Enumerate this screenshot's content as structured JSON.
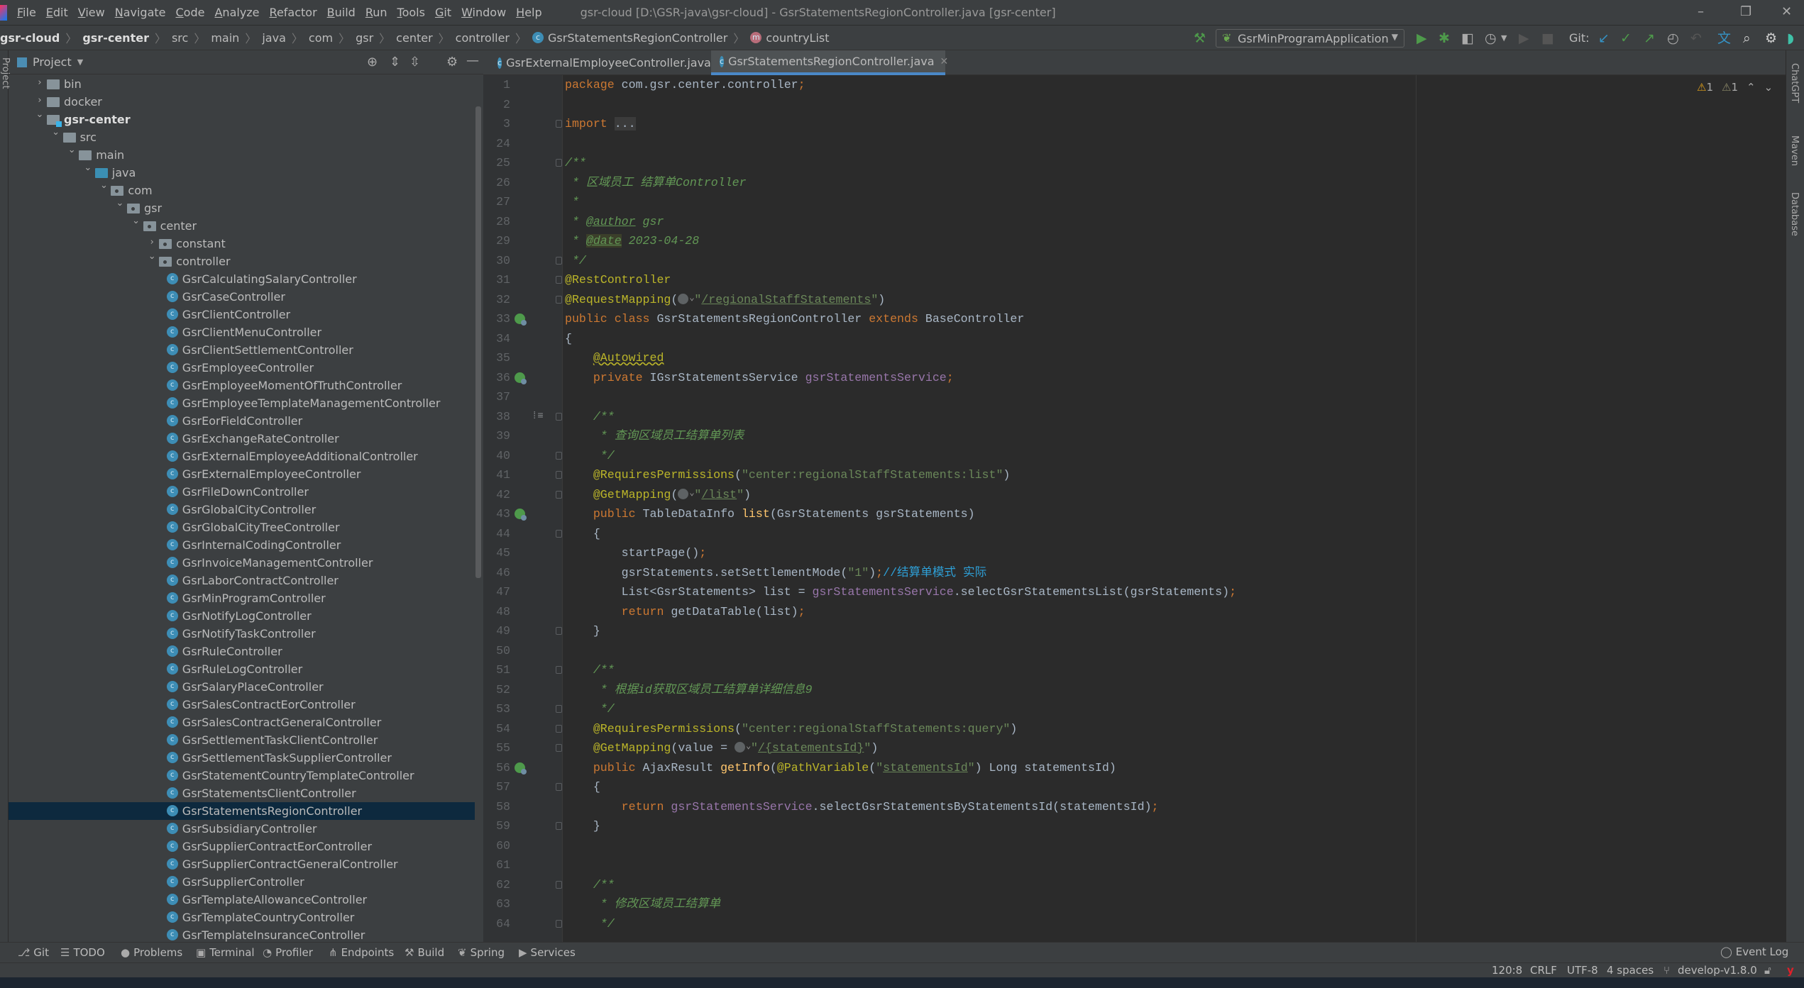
{
  "menubar": {
    "items": [
      "File",
      "Edit",
      "View",
      "Navigate",
      "Code",
      "Analyze",
      "Refactor",
      "Build",
      "Run",
      "Tools",
      "Git",
      "Window",
      "Help"
    ],
    "title": "gsr-cloud [D:\\GSR-java\\gsr-cloud] - GsrStatementsRegionController.java [gsr-center]"
  },
  "breadcrumb": [
    "gsr-cloud",
    "gsr-center",
    "src",
    "main",
    "java",
    "com",
    "gsr",
    "center",
    "controller",
    "GsrStatementsRegionController",
    "countryList"
  ],
  "toolbar": {
    "run_config": "GsrMinProgramApplication",
    "git_label": "Git:"
  },
  "project": {
    "title": "Project",
    "tree": [
      {
        "label": "bin",
        "level": 0,
        "kind": "folder",
        "expanded": false
      },
      {
        "label": "docker",
        "level": 0,
        "kind": "folder",
        "expanded": false
      },
      {
        "label": "gsr-center",
        "level": 0,
        "kind": "module",
        "expanded": true
      },
      {
        "label": "src",
        "level": 1,
        "kind": "folder",
        "expanded": true
      },
      {
        "label": "main",
        "level": 2,
        "kind": "folder",
        "expanded": true
      },
      {
        "label": "java",
        "level": 3,
        "kind": "source",
        "expanded": true
      },
      {
        "label": "com",
        "level": 4,
        "kind": "package",
        "expanded": true
      },
      {
        "label": "gsr",
        "level": 5,
        "kind": "package",
        "expanded": true
      },
      {
        "label": "center",
        "level": 6,
        "kind": "package",
        "expanded": true
      },
      {
        "label": "constant",
        "level": 7,
        "kind": "package",
        "expanded": false
      },
      {
        "label": "controller",
        "level": 7,
        "kind": "package",
        "expanded": true
      },
      {
        "label": "GsrCalculatingSalaryController",
        "level": 8,
        "kind": "class"
      },
      {
        "label": "GsrCaseController",
        "level": 8,
        "kind": "class"
      },
      {
        "label": "GsrClientController",
        "level": 8,
        "kind": "class"
      },
      {
        "label": "GsrClientMenuController",
        "level": 8,
        "kind": "class"
      },
      {
        "label": "GsrClientSettlementController",
        "level": 8,
        "kind": "class"
      },
      {
        "label": "GsrEmployeeController",
        "level": 8,
        "kind": "class"
      },
      {
        "label": "GsrEmployeeMomentOfTruthController",
        "level": 8,
        "kind": "class"
      },
      {
        "label": "GsrEmployeeTemplateManagementController",
        "level": 8,
        "kind": "class"
      },
      {
        "label": "GsrEorFieldController",
        "level": 8,
        "kind": "class"
      },
      {
        "label": "GsrExchangeRateController",
        "level": 8,
        "kind": "class"
      },
      {
        "label": "GsrExternalEmployeeAdditionalController",
        "level": 8,
        "kind": "class"
      },
      {
        "label": "GsrExternalEmployeeController",
        "level": 8,
        "kind": "class"
      },
      {
        "label": "GsrFileDownController",
        "level": 8,
        "kind": "class"
      },
      {
        "label": "GsrGlobalCityController",
        "level": 8,
        "kind": "class"
      },
      {
        "label": "GsrGlobalCityTreeController",
        "level": 8,
        "kind": "class"
      },
      {
        "label": "GsrInternalCodingController",
        "level": 8,
        "kind": "class"
      },
      {
        "label": "GsrInvoiceManagementController",
        "level": 8,
        "kind": "class"
      },
      {
        "label": "GsrLaborContractController",
        "level": 8,
        "kind": "class"
      },
      {
        "label": "GsrMinProgramController",
        "level": 8,
        "kind": "class"
      },
      {
        "label": "GsrNotifyLogController",
        "level": 8,
        "kind": "class"
      },
      {
        "label": "GsrNotifyTaskController",
        "level": 8,
        "kind": "class"
      },
      {
        "label": "GsrRuleController",
        "level": 8,
        "kind": "class"
      },
      {
        "label": "GsrRuleLogController",
        "level": 8,
        "kind": "class"
      },
      {
        "label": "GsrSalaryPlaceController",
        "level": 8,
        "kind": "class"
      },
      {
        "label": "GsrSalesContractEorController",
        "level": 8,
        "kind": "class"
      },
      {
        "label": "GsrSalesContractGeneralController",
        "level": 8,
        "kind": "class"
      },
      {
        "label": "GsrSettlementTaskClientController",
        "level": 8,
        "kind": "class"
      },
      {
        "label": "GsrSettlementTaskSupplierController",
        "level": 8,
        "kind": "class"
      },
      {
        "label": "GsrStatementCountryTemplateController",
        "level": 8,
        "kind": "class"
      },
      {
        "label": "GsrStatementsClientController",
        "level": 8,
        "kind": "class"
      },
      {
        "label": "GsrStatementsRegionController",
        "level": 8,
        "kind": "class",
        "selected": true
      },
      {
        "label": "GsrSubsidiaryController",
        "level": 8,
        "kind": "class"
      },
      {
        "label": "GsrSupplierContractEorController",
        "level": 8,
        "kind": "class"
      },
      {
        "label": "GsrSupplierContractGeneralController",
        "level": 8,
        "kind": "class"
      },
      {
        "label": "GsrSupplierController",
        "level": 8,
        "kind": "class"
      },
      {
        "label": "GsrTemplateAllowanceController",
        "level": 8,
        "kind": "class"
      },
      {
        "label": "GsrTemplateCountryController",
        "level": 8,
        "kind": "class"
      },
      {
        "label": "GsrTemplateInsuranceController",
        "level": 8,
        "kind": "class"
      }
    ]
  },
  "tabs": [
    {
      "label": "GsrExternalEmployeeController.java",
      "active": false
    },
    {
      "label": "GsrStatementsRegionController.java",
      "active": true
    }
  ],
  "editor": {
    "warnings": [
      "1",
      "1"
    ],
    "lines": [
      {
        "n": "1",
        "t": [
          [
            "kw",
            "package"
          ],
          [
            "plain",
            " com.gsr.center.controller"
          ],
          [
            "kw",
            ";"
          ]
        ]
      },
      {
        "n": "2",
        "t": []
      },
      {
        "n": "3",
        "fold": true,
        "t": [
          [
            "kw",
            "import "
          ],
          [
            "foldtxt",
            "..."
          ]
        ]
      },
      {
        "n": "24",
        "t": []
      },
      {
        "n": "25",
        "fold": true,
        "t": [
          [
            "doc",
            "/**"
          ]
        ]
      },
      {
        "n": "26",
        "t": [
          [
            "doc",
            " * 区域员工 结算单Controller"
          ]
        ]
      },
      {
        "n": "27",
        "t": [
          [
            "doc",
            " *"
          ]
        ]
      },
      {
        "n": "28",
        "t": [
          [
            "doc",
            " * "
          ],
          [
            "doctag",
            "@author"
          ],
          [
            "doc",
            " gsr"
          ]
        ]
      },
      {
        "n": "29",
        "t": [
          [
            "doc",
            " * "
          ],
          [
            "doctaghl",
            "@date"
          ],
          [
            "doc",
            " 2023-04-28"
          ]
        ]
      },
      {
        "n": "30",
        "fold": true,
        "t": [
          [
            "doc",
            " */"
          ]
        ]
      },
      {
        "n": "31",
        "fold": true,
        "t": [
          [
            "ann",
            "@RestController"
          ]
        ]
      },
      {
        "n": "32",
        "fold": true,
        "t": [
          [
            "ann",
            "@RequestMapping"
          ],
          [
            "plain",
            "("
          ],
          [
            "globe",
            ""
          ],
          [
            "str",
            "\""
          ],
          [
            "url",
            "/regionalStaffStatements"
          ],
          [
            "str",
            "\""
          ],
          [
            "plain",
            ")"
          ]
        ]
      },
      {
        "n": "33",
        "bean": true,
        "t": [
          [
            "kw",
            "public class "
          ],
          [
            "plain",
            "GsrStatementsRegionController "
          ],
          [
            "kw",
            "extends "
          ],
          [
            "plain",
            "BaseController"
          ]
        ]
      },
      {
        "n": "34",
        "t": [
          [
            "plain",
            "{"
          ]
        ]
      },
      {
        "n": "35",
        "t": [
          [
            "plain",
            "    "
          ],
          [
            "annu",
            "@Autowired"
          ]
        ]
      },
      {
        "n": "36",
        "bean": true,
        "t": [
          [
            "kw",
            "    private "
          ],
          [
            "plain",
            "IGsrStatementsService "
          ],
          [
            "field",
            "gsrStatementsService"
          ],
          [
            "kw",
            ";"
          ]
        ]
      },
      {
        "n": "37",
        "t": []
      },
      {
        "n": "38",
        "fold": true,
        "impl": true,
        "t": [
          [
            "doc",
            "    /**"
          ]
        ]
      },
      {
        "n": "39",
        "t": [
          [
            "doc",
            "     * 查询区域员工结算单列表"
          ]
        ]
      },
      {
        "n": "40",
        "fold": true,
        "t": [
          [
            "doc",
            "     */"
          ]
        ]
      },
      {
        "n": "41",
        "fold": true,
        "t": [
          [
            "ann",
            "    @RequiresPermissions"
          ],
          [
            "plain",
            "("
          ],
          [
            "str",
            "\"center:regionalStaffStatements:list\""
          ],
          [
            "plain",
            ")"
          ]
        ]
      },
      {
        "n": "42",
        "fold": true,
        "t": [
          [
            "ann",
            "    @GetMapping"
          ],
          [
            "plain",
            "("
          ],
          [
            "globe",
            ""
          ],
          [
            "str",
            "\""
          ],
          [
            "url",
            "/list"
          ],
          [
            "str",
            "\""
          ],
          [
            "plain",
            ")"
          ]
        ]
      },
      {
        "n": "43",
        "bean": true,
        "t": [
          [
            "kw",
            "    public "
          ],
          [
            "plain",
            "TableDataInfo "
          ],
          [
            "fn",
            "list"
          ],
          [
            "plain",
            "(GsrStatements gsrStatements)"
          ]
        ]
      },
      {
        "n": "44",
        "fold": true,
        "t": [
          [
            "plain",
            "    {"
          ]
        ]
      },
      {
        "n": "45",
        "t": [
          [
            "plain",
            "        startPage()"
          ],
          [
            "kw",
            ";"
          ]
        ]
      },
      {
        "n": "46",
        "t": [
          [
            "plain",
            "        gsrStatements.setSettlementMode("
          ],
          [
            "str",
            "\"1\""
          ],
          [
            "plain",
            ")"
          ],
          [
            "kw",
            ";"
          ],
          [
            "cmt",
            "//结算单模式 实际"
          ]
        ]
      },
      {
        "n": "47",
        "t": [
          [
            "plain",
            "        List<GsrStatements> list = "
          ],
          [
            "field",
            "gsrStatementsService"
          ],
          [
            "plain",
            ".selectGsrStatementsList(gsrStatements)"
          ],
          [
            "kw",
            ";"
          ]
        ]
      },
      {
        "n": "48",
        "t": [
          [
            "kw",
            "        return "
          ],
          [
            "plain",
            "getDataTable(list)"
          ],
          [
            "kw",
            ";"
          ]
        ]
      },
      {
        "n": "49",
        "fold": true,
        "t": [
          [
            "plain",
            "    }"
          ]
        ]
      },
      {
        "n": "50",
        "t": []
      },
      {
        "n": "51",
        "fold": true,
        "t": [
          [
            "doc",
            "    /**"
          ]
        ]
      },
      {
        "n": "52",
        "t": [
          [
            "doc",
            "     * 根据id获取区域员工结算单详细信息9"
          ]
        ]
      },
      {
        "n": "53",
        "fold": true,
        "t": [
          [
            "doc",
            "     */"
          ]
        ]
      },
      {
        "n": "54",
        "fold": true,
        "t": [
          [
            "ann",
            "    @RequiresPermissions"
          ],
          [
            "plain",
            "("
          ],
          [
            "str",
            "\"center:regionalStaffStatements:query\""
          ],
          [
            "plain",
            ")"
          ]
        ]
      },
      {
        "n": "55",
        "fold": true,
        "t": [
          [
            "ann",
            "    @GetMapping"
          ],
          [
            "plain",
            "(value = "
          ],
          [
            "globe",
            ""
          ],
          [
            "str",
            "\""
          ],
          [
            "url",
            "/{statementsId}"
          ],
          [
            "str",
            "\""
          ],
          [
            "plain",
            ")"
          ]
        ]
      },
      {
        "n": "56",
        "bean": true,
        "t": [
          [
            "kw",
            "    public "
          ],
          [
            "plain",
            "AjaxResult "
          ],
          [
            "fn",
            "getInfo"
          ],
          [
            "plain",
            "("
          ],
          [
            "ann",
            "@PathVariable"
          ],
          [
            "plain",
            "("
          ],
          [
            "str",
            "\""
          ],
          [
            "urlp",
            "statementsId"
          ],
          [
            "str",
            "\""
          ],
          [
            "plain",
            ") Long statementsId)"
          ]
        ]
      },
      {
        "n": "57",
        "fold": true,
        "t": [
          [
            "plain",
            "    {"
          ]
        ]
      },
      {
        "n": "58",
        "t": [
          [
            "kw",
            "        return "
          ],
          [
            "field",
            "gsrStatementsService"
          ],
          [
            "plain",
            ".selectGsrStatementsByStatementsId(statementsId)"
          ],
          [
            "kw",
            ";"
          ]
        ]
      },
      {
        "n": "59",
        "fold": true,
        "t": [
          [
            "plain",
            "    }"
          ]
        ]
      },
      {
        "n": "60",
        "t": []
      },
      {
        "n": "61",
        "t": []
      },
      {
        "n": "62",
        "fold": true,
        "t": [
          [
            "doc",
            "    /**"
          ]
        ]
      },
      {
        "n": "63",
        "t": [
          [
            "doc",
            "     * 修改区域员工结算单"
          ]
        ]
      },
      {
        "n": "64",
        "fold": true,
        "t": [
          [
            "doc",
            "     */"
          ]
        ]
      }
    ]
  },
  "right_stripe": [
    "ChatGPT",
    "Maven",
    "Database"
  ],
  "left_stripe": [
    "Project"
  ],
  "bottom_tools": [
    {
      "icon": "git-icon",
      "glyph": "⎇",
      "label": "Git"
    },
    {
      "icon": "todo-icon",
      "glyph": "☰",
      "label": "TODO"
    },
    {
      "icon": "problems-icon",
      "glyph": "●",
      "label": "Problems"
    },
    {
      "icon": "terminal-icon",
      "glyph": "▣",
      "label": "Terminal"
    },
    {
      "icon": "profiler-icon",
      "glyph": "◔",
      "label": "Profiler"
    },
    {
      "icon": "endpoints-icon",
      "glyph": "⋔",
      "label": "Endpoints"
    },
    {
      "icon": "build-icon",
      "glyph": "⚒",
      "label": "Build"
    },
    {
      "icon": "spring-icon",
      "glyph": "❦",
      "label": "Spring"
    },
    {
      "icon": "services-icon",
      "glyph": "▶",
      "label": "Services"
    }
  ],
  "event_log": "Event Log",
  "status": {
    "position": "120:8",
    "line_sep": "CRLF",
    "encoding": "UTF-8",
    "indent": "4 spaces",
    "branch": "develop-v1.8.0"
  },
  "colors": {
    "accent": "#4A88C7",
    "selection": "#0D293E",
    "editor_bg": "#2B2B2B",
    "panel_bg": "#3C3F41"
  }
}
